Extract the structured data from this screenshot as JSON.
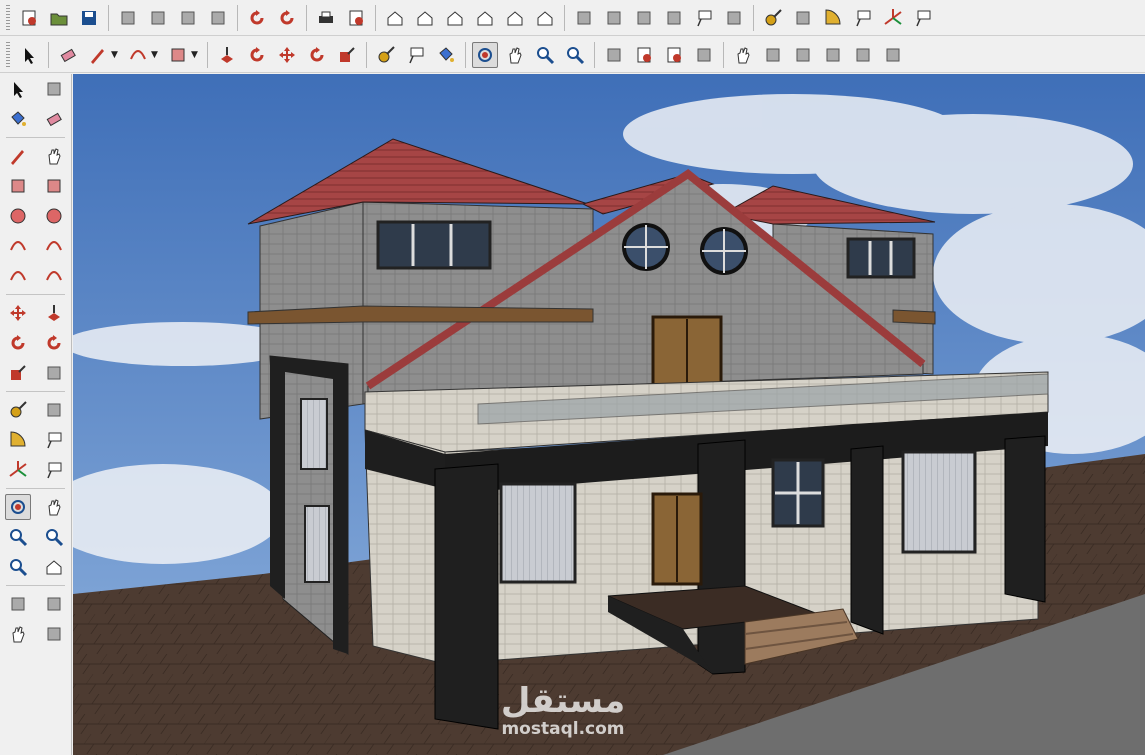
{
  "toolbar_top": [
    {
      "icon": "new-file-icon"
    },
    {
      "icon": "open-folder-icon"
    },
    {
      "icon": "save-icon"
    },
    {
      "icon": "cut-icon"
    },
    {
      "icon": "copy-icon"
    },
    {
      "icon": "paste-icon"
    },
    {
      "icon": "erase-icon"
    },
    {
      "icon": "undo-icon"
    },
    {
      "icon": "redo-icon"
    },
    {
      "icon": "print-icon"
    },
    {
      "icon": "model-info-icon"
    },
    {
      "icon": "iso-view-icon"
    },
    {
      "icon": "top-view-icon"
    },
    {
      "icon": "front-view-icon"
    },
    {
      "icon": "right-view-icon"
    },
    {
      "icon": "back-view-icon"
    },
    {
      "icon": "left-view-icon"
    },
    {
      "icon": "xray-icon"
    },
    {
      "icon": "wireframe-icon"
    },
    {
      "icon": "hidden-line-icon"
    },
    {
      "icon": "shaded-icon"
    },
    {
      "icon": "shaded-texture-icon"
    },
    {
      "icon": "monochrome-icon"
    },
    {
      "icon": "tape-measure-icon"
    },
    {
      "icon": "dimension-icon"
    },
    {
      "icon": "protractor-icon"
    },
    {
      "icon": "text-icon"
    },
    {
      "icon": "axes-icon"
    },
    {
      "icon": "3d-text-icon"
    }
  ],
  "toolbar_second": [
    {
      "icon": "select-arrow-icon"
    },
    {
      "icon": "eraser-icon"
    },
    {
      "icon": "pencil-icon"
    },
    {
      "icon": "arc-icon"
    },
    {
      "icon": "rectangle-icon"
    },
    {
      "icon": "push-pull-icon"
    },
    {
      "icon": "follow-me-icon"
    },
    {
      "icon": "move-icon"
    },
    {
      "icon": "rotate-icon"
    },
    {
      "icon": "scale-icon"
    },
    {
      "icon": "tape-measure-icon"
    },
    {
      "icon": "text-icon"
    },
    {
      "icon": "paint-bucket-icon"
    },
    {
      "icon": "orbit-icon",
      "active": true
    },
    {
      "icon": "pan-hand-icon"
    },
    {
      "icon": "zoom-icon"
    },
    {
      "icon": "zoom-extents-icon"
    },
    {
      "icon": "section-plane-icon"
    },
    {
      "icon": "components-icon"
    },
    {
      "icon": "get-models-icon"
    },
    {
      "icon": "share-model-icon"
    },
    {
      "icon": "walk-icon"
    },
    {
      "icon": "look-around-icon"
    },
    {
      "icon": "position-camera-icon"
    },
    {
      "icon": "sandbox-icon"
    },
    {
      "icon": "drape-icon"
    },
    {
      "icon": "flip-edge-icon"
    }
  ],
  "left_tools": [
    [
      "select-arrow-icon",
      "component-icon"
    ],
    [
      "paint-bucket-icon",
      "eraser-icon"
    ],
    [
      "pencil-icon",
      "freehand-icon"
    ],
    [
      "rectangle-icon",
      "rotated-rectangle-icon"
    ],
    [
      "circle-icon",
      "polygon-icon"
    ],
    [
      "arc-icon",
      "2-point-arc-icon"
    ],
    [
      "3-point-arc-icon",
      "pie-icon"
    ],
    [
      "move-icon",
      "push-pull-icon"
    ],
    [
      "rotate-icon",
      "follow-me-icon"
    ],
    [
      "scale-icon",
      "offset-icon"
    ],
    [
      "tape-measure-icon",
      "dimension-icon"
    ],
    [
      "protractor-icon",
      "text-icon"
    ],
    [
      "axes-icon",
      "3d-text-icon"
    ],
    [
      "orbit-icon",
      "pan-hand-icon"
    ],
    [
      "zoom-icon",
      "zoom-window-icon"
    ],
    [
      "zoom-extents-icon",
      "previous-view-icon"
    ],
    [
      "position-camera-icon",
      "look-around-icon"
    ],
    [
      "walk-icon",
      "section-plane-icon"
    ]
  ],
  "watermark": {
    "arabic": "مستقل",
    "latin": "mostaql.com"
  },
  "colors": {
    "sky": "#5c87c6",
    "ground": "#4a3a30",
    "roof": "#9c3a3a",
    "wall": "#8d8d8d",
    "accent": "#c0392b"
  }
}
